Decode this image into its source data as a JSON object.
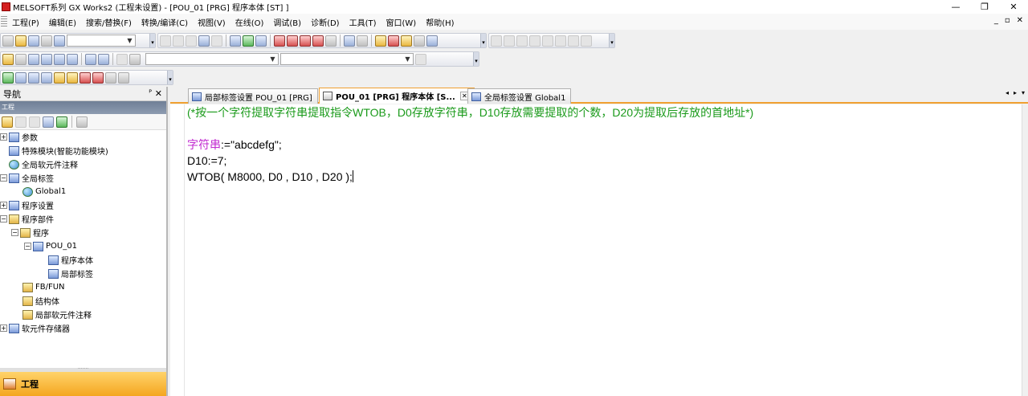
{
  "window": {
    "title": "MELSOFT系列 GX Works2 (工程未设置) - [POU_01 [PRG] 程序本体 [ST] ]",
    "controls": [
      "—",
      "❐",
      "✕"
    ]
  },
  "menu": {
    "items": [
      "工程(P)",
      "编辑(E)",
      "搜索/替换(F)",
      "转换/编译(C)",
      "视图(V)",
      "在线(O)",
      "调试(B)",
      "诊断(D)",
      "工具(T)",
      "窗口(W)",
      "帮助(H)"
    ],
    "right_controls": [
      "_",
      "▫",
      "✕"
    ]
  },
  "navigation": {
    "title": "导航",
    "pin": "ᴾ",
    "close": "✕",
    "subheader": "工程",
    "tree": [
      {
        "label": "参数",
        "expander": "+"
      },
      {
        "label": "特殊模块(智能功能模块)",
        "expander": ""
      },
      {
        "label": "全局软元件注释",
        "expander": ""
      },
      {
        "label": "全局标签",
        "expander": "−"
      },
      {
        "label": "Global1",
        "expander": ""
      },
      {
        "label": "程序设置",
        "expander": "+"
      },
      {
        "label": "程序部件",
        "expander": "−"
      },
      {
        "label": "程序",
        "expander": "−"
      },
      {
        "label": "POU_01",
        "expander": "−"
      },
      {
        "label": "程序本体",
        "expander": ""
      },
      {
        "label": "局部标签",
        "expander": ""
      },
      {
        "label": "FB/FUN",
        "expander": ""
      },
      {
        "label": "结构体",
        "expander": ""
      },
      {
        "label": "局部软元件注释",
        "expander": ""
      },
      {
        "label": "软元件存储器",
        "expander": "+"
      }
    ],
    "bottom_tab": "工程"
  },
  "tabs": [
    {
      "label": "局部标签设置 POU_01 [PRG]",
      "active": false
    },
    {
      "label": "POU_01 [PRG] 程序本体 [S...",
      "active": true,
      "close": "✕"
    },
    {
      "label": "全局标签设置 Global1",
      "active": false
    }
  ],
  "tab_nav": [
    "◂",
    "▸",
    "▾"
  ],
  "editor": {
    "comment": "(*按一个字符提取字符串提取指令WTOB，D0存放字符串，D10存放需要提取的个数，D20为提取后存放的首地址*)",
    "line2_var": "字符串",
    "line2_rest": ":=\"abcdefg\";",
    "line3": "D10:=7;",
    "line4": "WTOB( M8000, D0 , D10 , D20 );"
  },
  "colors": {
    "comment": "#1a9a1a",
    "variable": "#c22bd0",
    "active_tab_accent": "#f0a030"
  }
}
